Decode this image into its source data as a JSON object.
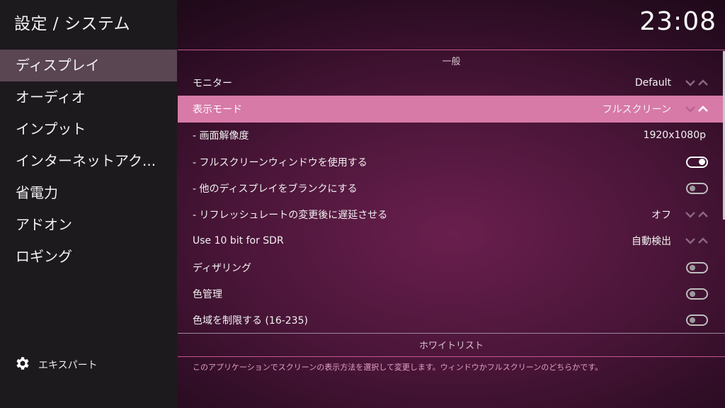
{
  "header": {
    "title": "設定 / システム",
    "clock": "23:08"
  },
  "sidebar": {
    "items": [
      {
        "label": "ディスプレイ",
        "active": true
      },
      {
        "label": "オーディオ"
      },
      {
        "label": "インプット"
      },
      {
        "label": "インターネットアク..."
      },
      {
        "label": "省電力"
      },
      {
        "label": "アドオン"
      },
      {
        "label": "ロギング"
      }
    ],
    "expert_label": "エキスパート"
  },
  "main": {
    "section_title": "一般",
    "rows": [
      {
        "label": "モニター",
        "value": "Default",
        "control": "spinner"
      },
      {
        "label": "表示モード",
        "value": "フルスクリーン",
        "control": "spinner",
        "focused": true
      },
      {
        "label": "- 画面解像度",
        "value": "1920x1080p",
        "control": "value"
      },
      {
        "label": "- フルスクリーンウィンドウを使用する",
        "control": "toggle",
        "on": true
      },
      {
        "label": "- 他のディスプレイをブランクにする",
        "control": "toggle",
        "on": false
      },
      {
        "label": "- リフレッシュレートの変更後に遅延させる",
        "value": "オフ",
        "control": "spinner"
      },
      {
        "label": "Use 10 bit for SDR",
        "value": "自動検出",
        "control": "spinner"
      },
      {
        "label": "ディザリング",
        "control": "toggle",
        "on": false
      },
      {
        "label": "色管理",
        "control": "toggle",
        "on": false
      },
      {
        "label": "色域を制限する (16-235)",
        "control": "toggle",
        "on": false
      }
    ],
    "next_section_title": "ホワイトリスト",
    "description": "このアプリケーションでスクリーンの表示方法を選択して変更します。ウィンドウかフルスクリーンのどちらかです。"
  },
  "colors": {
    "accent": "#d77aa8",
    "sidebar_bg": "#1d1a1d",
    "sidebar_active": "#5a4553",
    "description_text": "#e2a0c4"
  }
}
